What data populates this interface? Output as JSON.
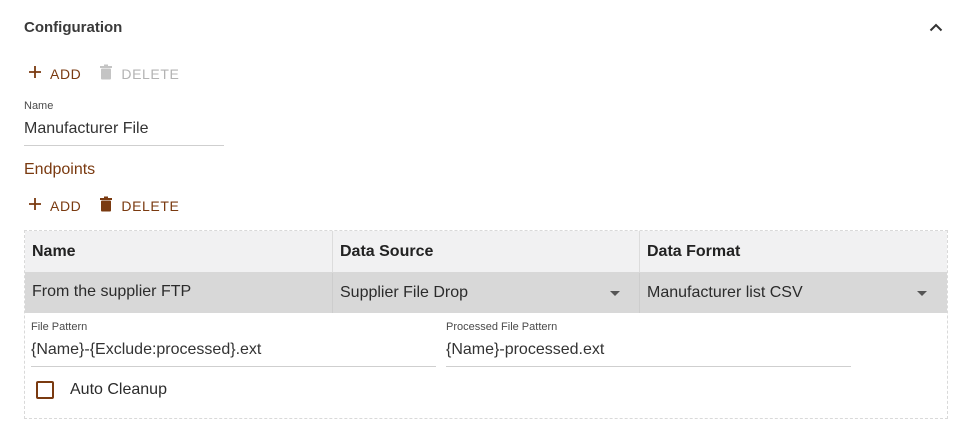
{
  "section": {
    "title": "Configuration"
  },
  "config_toolbar": {
    "add_label": "ADD",
    "delete_label": "DELETE"
  },
  "name_field": {
    "label": "Name",
    "value": "Manufacturer File"
  },
  "endpoints": {
    "title": "Endpoints",
    "toolbar": {
      "add_label": "ADD",
      "delete_label": "DELETE"
    },
    "table": {
      "headers": [
        "Name",
        "Data Source",
        "Data Format"
      ],
      "rows": [
        {
          "name": "From the supplier FTP",
          "data_source": "Supplier File Drop",
          "data_format": "Manufacturer list CSV"
        }
      ]
    },
    "detail": {
      "file_pattern": {
        "label": "File Pattern",
        "value": "{Name}-{Exclude:processed}.ext"
      },
      "processed_file_pattern": {
        "label": "Processed File Pattern",
        "value": "{Name}-processed.ext"
      },
      "auto_cleanup": {
        "label": "Auto Cleanup",
        "checked": false
      }
    }
  },
  "colors": {
    "accent": "#7a3a10",
    "disabled": "#b3b3b3",
    "header_bg": "#f1f1f2",
    "selected_row_bg": "#d8d8d8"
  },
  "icons": {
    "add": "plus-icon",
    "delete": "trash-icon",
    "collapse": "chevron-up-icon",
    "dropdown": "caret-down-icon"
  }
}
